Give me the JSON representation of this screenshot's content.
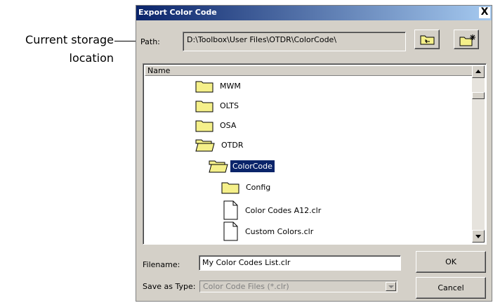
{
  "callout": {
    "line1": "Current storage",
    "line2": "location"
  },
  "dialog": {
    "title": "Export Color Code",
    "close": "X",
    "path_label": "Path:",
    "path_value": "D:\\Toolbox\\User Files\\OTDR\\ColorCode\\",
    "list_header": "Name",
    "items": [
      {
        "name": "MWM",
        "icon": "folder-icon"
      },
      {
        "name": "OLTS",
        "icon": "folder-icon"
      },
      {
        "name": "OSA",
        "icon": "folder-icon"
      },
      {
        "name": "OTDR",
        "icon": "open-folder-icon"
      },
      {
        "name": "ColorCode",
        "icon": "open-folder-icon",
        "selected": true
      },
      {
        "name": "Config",
        "icon": "folder-icon"
      },
      {
        "name": "Color Codes A12.clr",
        "icon": "file-icon"
      },
      {
        "name": "Custom Colors.clr",
        "icon": "file-icon"
      }
    ],
    "filename_label": "Filename:",
    "filename_value": "My Color Codes List.clr",
    "type_label": "Save as Type:",
    "type_value": "Color Code Files (*.clr)",
    "ok_label": "OK",
    "cancel_label": "Cancel"
  },
  "colors": {
    "titlebar": "#0a246a",
    "face": "#d4d0c8",
    "folder": "#f5f08a",
    "selection": "#0a246a"
  }
}
